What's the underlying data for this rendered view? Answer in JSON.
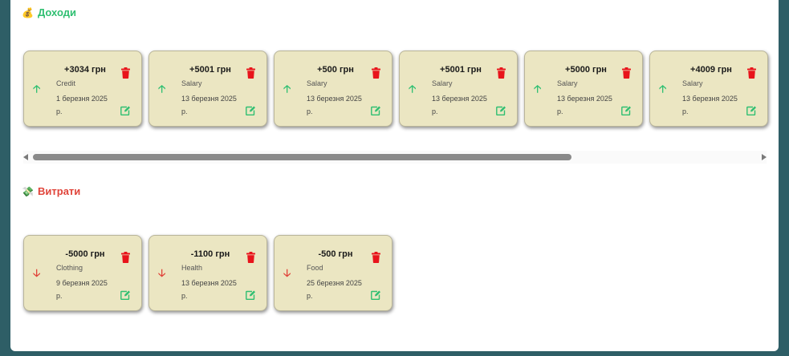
{
  "income": {
    "title": "Доходи",
    "icon": "money-bag-icon",
    "emoji": "💰",
    "color": "#2fbf71",
    "items": [
      {
        "amount": "+3034 грн",
        "category": "Credit",
        "date": "1 березня 2025 р."
      },
      {
        "amount": "+5001 грн",
        "category": "Salary",
        "date": "13 березня 2025 р."
      },
      {
        "amount": "+500 грн",
        "category": "Salary",
        "date": "13 березня 2025 р."
      },
      {
        "amount": "+5001 грн",
        "category": "Salary",
        "date": "13 березня 2025 р."
      },
      {
        "amount": "+5000 грн",
        "category": "Salary",
        "date": "13 березня 2025 р."
      },
      {
        "amount": "+4009 грн",
        "category": "Salary",
        "date": "13 березня 2025 р."
      }
    ]
  },
  "expenses": {
    "title": "Витрати",
    "icon": "money-wings-icon",
    "emoji": "💸",
    "color": "#e0443a",
    "items": [
      {
        "amount": "-5000 грн",
        "category": "Clothing",
        "date": "9 березня 2025 р."
      },
      {
        "amount": "-1100 грн",
        "category": "Health",
        "date": "13 березня 2025 р."
      },
      {
        "amount": "-500 грн",
        "category": "Food",
        "date": "25 березня 2025 р."
      }
    ]
  },
  "icons": {
    "income_arrow": "🡡",
    "expense_arrow": "🡣",
    "delete": "trash-icon",
    "edit": "edit-icon"
  },
  "colors": {
    "card_bg": "#ebe6c2",
    "delete": "#e8141b",
    "edit": "#2fbf71",
    "page_bg": "#2e5e66"
  }
}
